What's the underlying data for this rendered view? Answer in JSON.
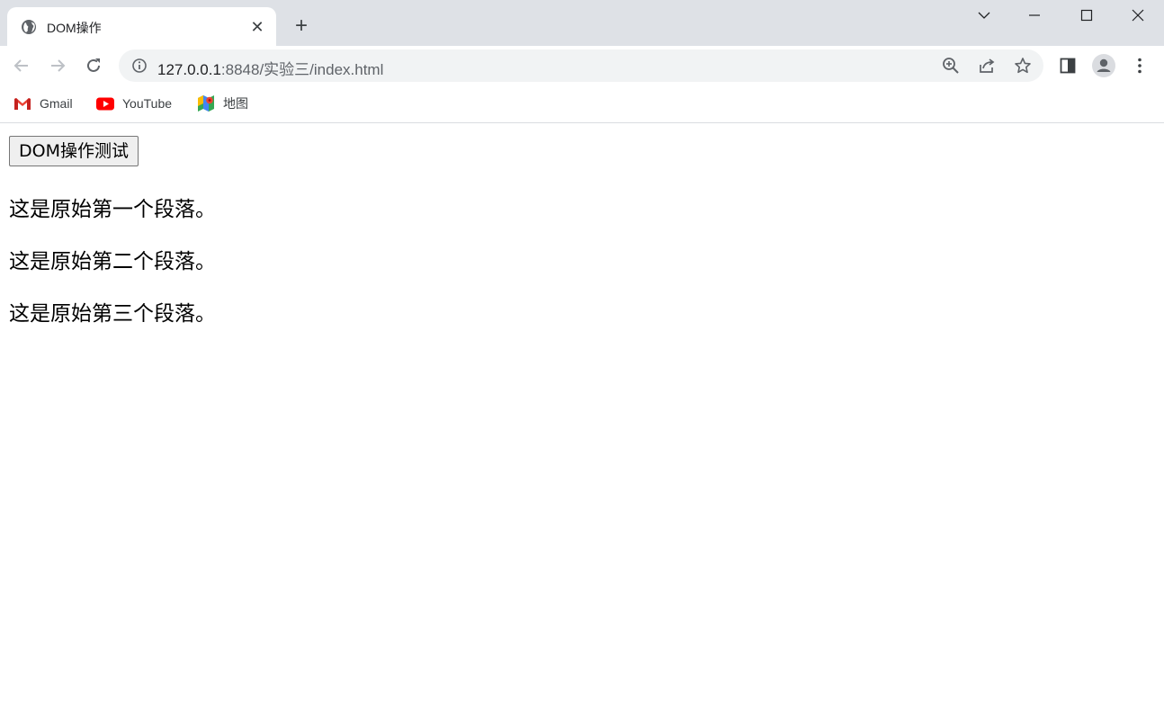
{
  "tab": {
    "title": "DOM操作",
    "close_glyph": "✕",
    "new_tab_glyph": "+"
  },
  "window_controls": [
    "tab-search",
    "minimize",
    "maximize",
    "close"
  ],
  "toolbar": {
    "url_host": "127.0.0.1",
    "url_path": ":8848/实验三/index.html",
    "icons": [
      "back-icon",
      "forward-icon",
      "reload-icon",
      "info-icon",
      "zoom-icon",
      "share-icon",
      "star-icon",
      "side-panel-icon",
      "profile-icon",
      "menu-icon"
    ]
  },
  "bookmarks": [
    {
      "label": "Gmail",
      "icon": "gmail-icon"
    },
    {
      "label": "YouTube",
      "icon": "youtube-icon"
    },
    {
      "label": "地图",
      "icon": "maps-icon"
    }
  ],
  "colors": {
    "tabstrip": "#dee1e6",
    "omnibox": "#f1f3f4",
    "youtube_red": "#ff0000",
    "gmail_red": "#ea4335"
  },
  "page": {
    "button_label": "DOM操作测试",
    "paragraphs": [
      "这是原始第一个段落。",
      "这是原始第二个段落。",
      "这是原始第三个段落。"
    ]
  }
}
